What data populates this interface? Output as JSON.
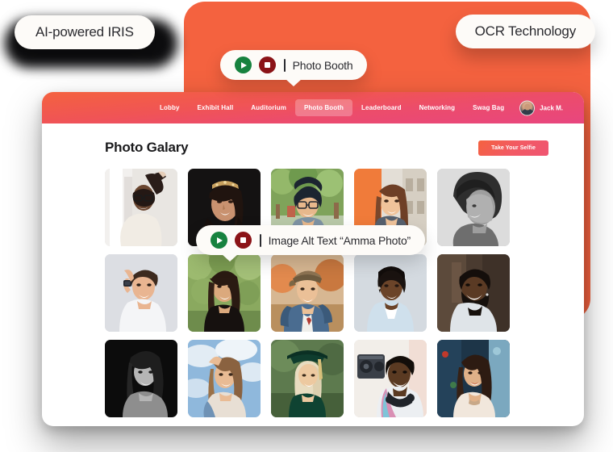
{
  "badges": {
    "ai": "AI-powered IRIS",
    "ocr": "OCR Technology"
  },
  "tooltips": [
    {
      "id": "photo-booth",
      "label": "Photo Booth",
      "play_icon": "play-icon",
      "stop_icon": "stop-icon"
    },
    {
      "id": "image-alt",
      "label": "Image Alt Text “Amma Photo”",
      "play_icon": "play-icon",
      "stop_icon": "stop-icon"
    }
  ],
  "nav": {
    "items": [
      {
        "label": "Lobby",
        "active": false
      },
      {
        "label": "Exhibit Hall",
        "active": false
      },
      {
        "label": "Auditorium",
        "active": false
      },
      {
        "label": "Photo Booth",
        "active": true
      },
      {
        "label": "Leaderboard",
        "active": false
      },
      {
        "label": "Networking",
        "active": false
      },
      {
        "label": "Swag Bag",
        "active": false
      }
    ],
    "user": {
      "name": "Jack M.",
      "avatar": "user-avatar"
    }
  },
  "page": {
    "title": "Photo Galary",
    "primary_button": "Take Your Selfie"
  },
  "gallery": {
    "columns": 5,
    "rows": 3,
    "photos": [
      {
        "alt": "Woman in glasses with arm raised by white staircase",
        "key": "p1"
      },
      {
        "alt": "Woman with tiara on dark background",
        "key": "p2"
      },
      {
        "alt": "Young man with glasses smiling outdoors by trees",
        "key": "p3"
      },
      {
        "alt": "Woman smiling in front of orange wall",
        "key": "p4"
      },
      {
        "alt": "Black and white portrait of young man in profile",
        "key": "p5"
      },
      {
        "alt": "Man with watch touching hair smiling",
        "key": "p6"
      },
      {
        "alt": "Amma Photo - woman smiling in black top outdoors",
        "key": "p7"
      },
      {
        "alt": "Man in cap and denim jacket with backpack",
        "key": "p8"
      },
      {
        "alt": "Woman in light blue collared shirt smiling",
        "key": "p9"
      },
      {
        "alt": "Bearded man laughing",
        "key": "p10"
      },
      {
        "alt": "Black and white photo of woman looking down smiling",
        "key": "p11"
      },
      {
        "alt": "Woman with hand in hair against cloudy sky",
        "key": "p12"
      },
      {
        "alt": "Graduate in cap and gown smiling",
        "key": "p13"
      },
      {
        "alt": "Man with headphones and boombox",
        "key": "p14"
      },
      {
        "alt": "Woman with long hair smiling outdoors at night",
        "key": "p15"
      }
    ]
  },
  "colors": {
    "orange_panel": "#f4623f",
    "nav_gradient_start": "#f4623f",
    "nav_gradient_end": "#e8467f",
    "button_gradient_start": "#f4623f",
    "button_gradient_end": "#ef5572",
    "play_green": "#17823f",
    "stop_red": "#8b1317",
    "pill_background": "#fdfbf8",
    "badge_shadow": "#0d0d0f"
  }
}
